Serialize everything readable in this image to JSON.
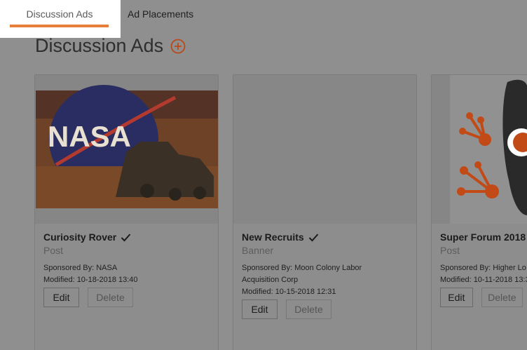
{
  "tabs": [
    {
      "label": "Discussion Ads",
      "active": true
    },
    {
      "label": "Ad Placements",
      "active": false
    }
  ],
  "page": {
    "title": "Discussion Ads"
  },
  "colors": {
    "accent": "#e67e3a",
    "overlay": "#8f8f8f"
  },
  "cards": [
    {
      "title": "Curiosity Rover",
      "type": "Post",
      "meta_lines": [
        "Sponsored By: NASA",
        "Modified: 10-18-2018 13:40"
      ],
      "image": "nasa-rover-photo",
      "edit_label": "Edit",
      "delete_label": "Delete",
      "image_text": "NASA"
    },
    {
      "title": "New Recruits",
      "type": "Banner",
      "meta_lines": [
        "Sponsored By: Moon Colony Labor",
        "Acquisition Corp",
        "Modified: 10-15-2018 12:31"
      ],
      "image": "blank",
      "edit_label": "Edit",
      "delete_label": "Delete"
    },
    {
      "title": "Super Forum 2018",
      "type": "Post",
      "meta_lines": [
        "Sponsored By: Higher Lo",
        "Modified: 10-11-2018 13:3"
      ],
      "image": "super-forum-logo",
      "edit_label": "Edit",
      "delete_label": "Delete"
    }
  ]
}
